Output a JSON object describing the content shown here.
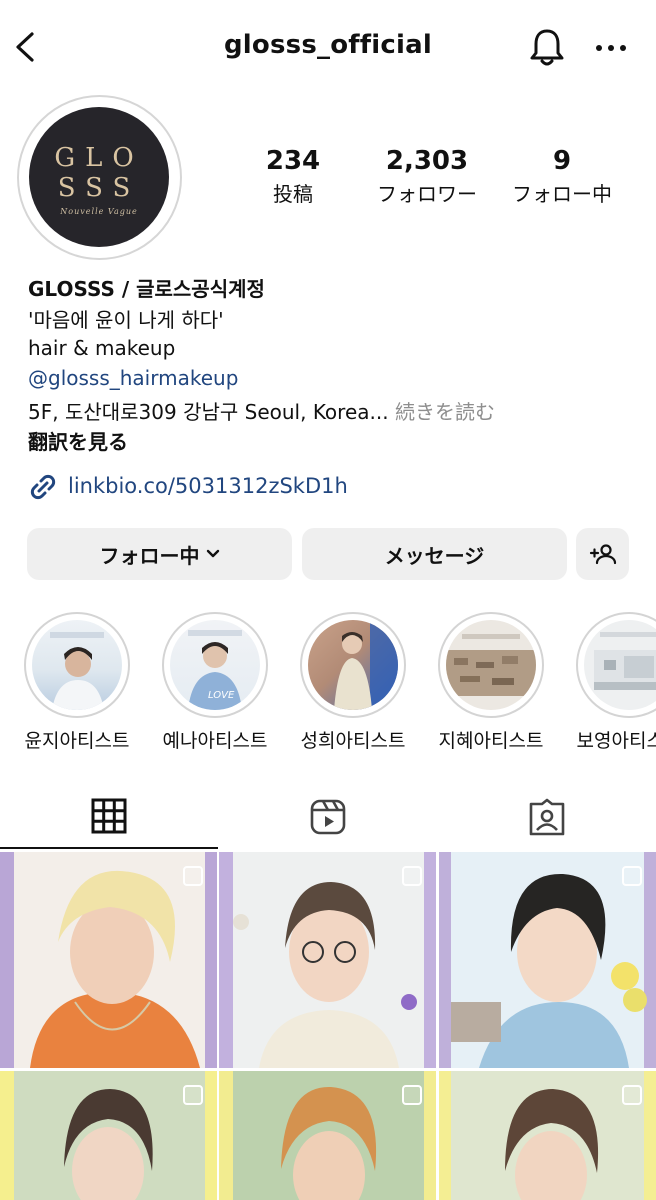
{
  "header": {
    "username": "glosss_official",
    "back_icon": "chevron-left-icon",
    "bell_icon": "bell-icon",
    "more_icon": "more-horizontal-icon"
  },
  "profile": {
    "avatar_logo": {
      "line1": "GLO",
      "line2": "SSS",
      "tagline": "Nouvelle Vague"
    },
    "stats": [
      {
        "value": "234",
        "label": "投稿"
      },
      {
        "value": "2,303",
        "label": "フォロワー"
      },
      {
        "value": "9",
        "label": "フォロー中"
      }
    ],
    "display_name": "GLOSSS / 글로스공식계정",
    "bio_lines": [
      "'마음에 윤이 나게 하다'",
      "hair & makeup"
    ],
    "mention": "@glosss_hairmakeup",
    "address": "5F, 도산대로309 강남구 Seoul, Korea...",
    "read_more": "続きを読む",
    "translate": "翻訳を見る",
    "link": "linkbio.co/5031312zSkD1h"
  },
  "actions": {
    "following_label": "フォロー中",
    "message_label": "メッセージ",
    "add_user_icon": "add-user-icon"
  },
  "highlights": [
    {
      "label": "윤지아티스트"
    },
    {
      "label": "예나아티스트"
    },
    {
      "label": "성희아티스트"
    },
    {
      "label": "지혜아티스트"
    },
    {
      "label": "보영아티스트"
    }
  ],
  "tabs": [
    {
      "name": "grid",
      "icon": "grid-icon"
    },
    {
      "name": "reels",
      "icon": "reels-icon"
    },
    {
      "name": "tagged",
      "icon": "tagged-icon"
    }
  ],
  "colors": {
    "link_blue": "#21467f",
    "button_bg": "#efefef",
    "muted": "#8e8e8e"
  }
}
